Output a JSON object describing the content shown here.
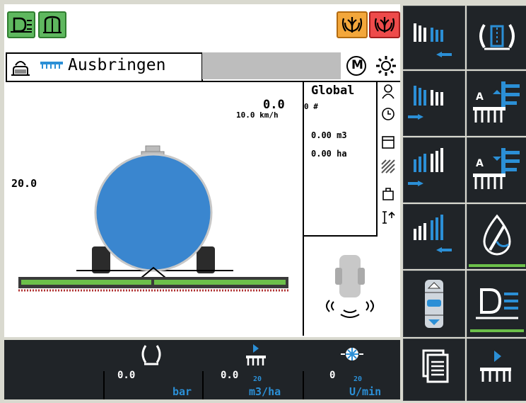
{
  "header": {
    "title": "Ausbringen"
  },
  "top_icons": [
    "headlight-icon",
    "door-icon",
    "crop-orange-icon",
    "crop-red-icon"
  ],
  "buttons": {
    "m_label": "M"
  },
  "main": {
    "speed": "0.0",
    "speed_sub": "10.0 km/h",
    "left_value": "20.0"
  },
  "global_panel": {
    "title": "Global",
    "count": "0 #",
    "volume": "0.00 m3",
    "area": "0.00 ha"
  },
  "status_bar": {
    "pressure": {
      "value": "0.0",
      "unit": "bar"
    },
    "rate": {
      "value": "0.0",
      "target": "20",
      "unit": "m3/ha"
    },
    "rpm": {
      "value": "0",
      "target": "20",
      "unit": "U/min"
    }
  },
  "colors": {
    "tank_blue": "#3a86cf",
    "boom_green": "#6cc04a",
    "accent_blue": "#2b8fd6",
    "panel_dark": "#202428"
  }
}
